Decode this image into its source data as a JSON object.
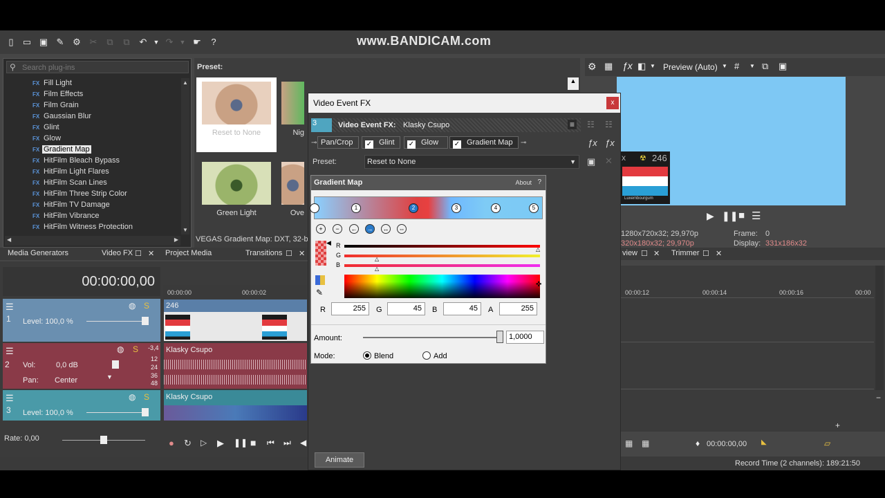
{
  "watermark": "www.BANDICAM.com",
  "plugins": {
    "search_placeholder": "Search plug-ins",
    "items": [
      "Fill Light",
      "Film Effects",
      "Film Grain",
      "Gaussian Blur",
      "Glint",
      "Glow",
      "Gradient Map",
      "HitFilm Bleach Bypass",
      "HitFilm Light Flares",
      "HitFilm Scan Lines",
      "HitFilm Three Strip Color",
      "HitFilm TV Damage",
      "HitFilm Vibrance",
      "HitFilm Witness Protection"
    ],
    "fx_tag": "FX",
    "selected_index": 6
  },
  "preset_panel": {
    "title": "Preset:",
    "thumbs": [
      "Reset to None",
      "Nig",
      "",
      "",
      "Green Light",
      "Ove"
    ],
    "status": "VEGAS Gradient Map: DXT, 32-bit"
  },
  "preview": {
    "mode": "Preview (Auto)",
    "overlay_number": "246",
    "overlay_caption": "Luxembourgum",
    "info_project": "1280x720x32; 29,970p",
    "info_preview": "320x180x32; 29,970p",
    "frame_label": "Frame:",
    "frame_value": "0",
    "display_label": "Display:",
    "display_value": "331x186x32"
  },
  "tabs": {
    "media_generators": "Media Generators",
    "video_fx": "Video FX",
    "project_media": "Project Media",
    "transitions": "Transitions",
    "view": "view",
    "trimmer": "Trimmer"
  },
  "timeline": {
    "timecode": "00:00:00,00",
    "ruler": [
      "00:00:00",
      "00:00:02"
    ],
    "ruler_right": [
      "00:00:12",
      "00:00:14",
      "00:00:16",
      "00:00"
    ],
    "track1": {
      "num": "1",
      "level": "Level: 100,0 %",
      "clip": "246"
    },
    "track2": {
      "num": "2",
      "vol_label": "Vol:",
      "vol_value": "0,0 dB",
      "pan_label": "Pan:",
      "pan_value": "Center",
      "clip": "Klasky Csupo",
      "meter": [
        "-3,4",
        "12",
        "24",
        "36",
        "48"
      ]
    },
    "track3": {
      "num": "3",
      "level": "Level: 100,0 %",
      "clip": "Klasky Csupo"
    },
    "rate": "Rate: 0,00",
    "right_timecode": "00:00:00,00"
  },
  "dialog": {
    "title": "Video Event FX",
    "close": "x",
    "fx_label": "Video Event FX:",
    "fx_value": "Klasky Csupo",
    "track_num": "3",
    "chain": [
      "Pan/Crop",
      "Glint",
      "Glow",
      "Gradient Map"
    ],
    "preset_label": "Preset:",
    "preset_value": "Reset to None",
    "animate": "Animate"
  },
  "gradient_map": {
    "title": "Gradient Map",
    "about": "About",
    "help": "?",
    "stops": [
      "1",
      "2",
      "3",
      "4",
      "5"
    ],
    "channels": [
      "R",
      "G",
      "B"
    ],
    "rgba_labels": [
      "R",
      "G",
      "B",
      "A"
    ],
    "rgba_values": [
      "255",
      "45",
      "45",
      "255"
    ],
    "amount_label": "Amount:",
    "amount_value": "1,0000",
    "amount_fraction": 1.0,
    "mode_label": "Mode:",
    "mode_blend": "Blend",
    "mode_add": "Add"
  },
  "status_bar": {
    "record_time": "Record Time (2 channels): 189:21:50"
  }
}
